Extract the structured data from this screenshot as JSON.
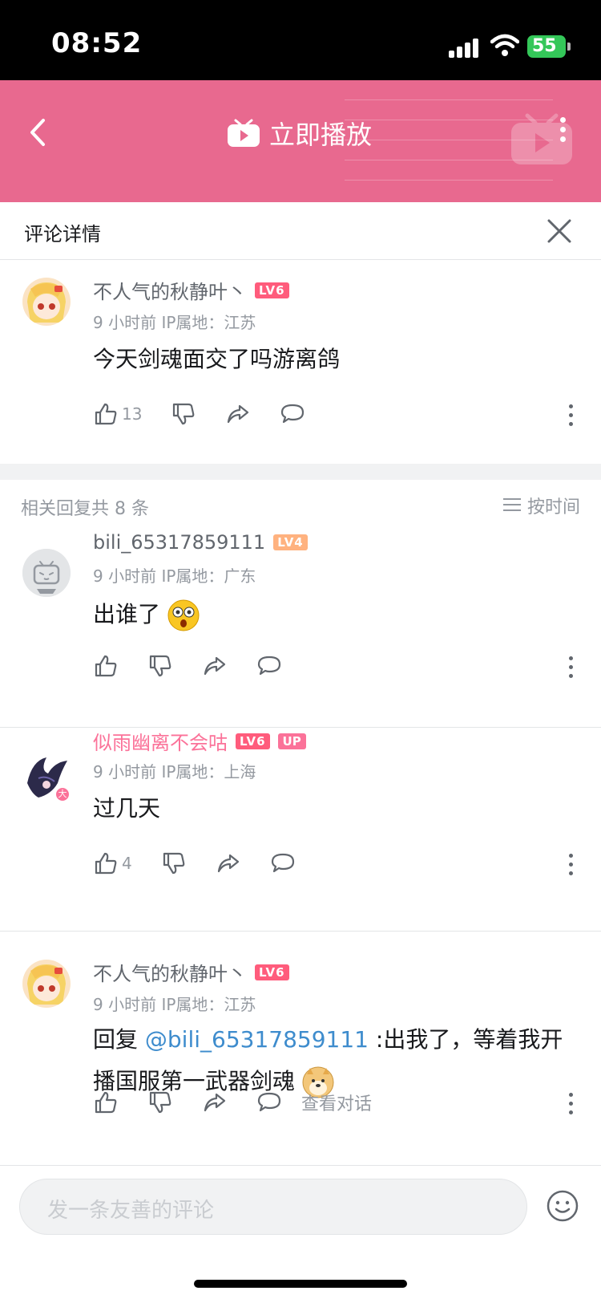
{
  "status_bar": {
    "time": "08:52",
    "battery": "55"
  },
  "header": {
    "play_label": "立即播放"
  },
  "detail": {
    "title": "评论详情"
  },
  "root_comment": {
    "username": "不人气的秋静叶丶",
    "level": "LV6",
    "meta": "9 小时前  IP属地：江苏",
    "content": "今天剑魂面交了吗游离鸽",
    "likes": "13"
  },
  "replies_section": {
    "count_label": "相关回复共 8 条",
    "sort_label": "按时间"
  },
  "replies": [
    {
      "username": "bili_65317859111",
      "level": "LV4",
      "meta": "9 小时前  IP属地：广东",
      "content": "出谁了"
    },
    {
      "username": "似雨幽离不会咕",
      "level": "LV6",
      "up_badge": "UP",
      "meta": "9 小时前  IP属地：上海",
      "content": "过几天",
      "likes": "4"
    },
    {
      "username": "不人气的秋静叶丶",
      "level": "LV6",
      "meta": "9 小时前  IP属地：江苏",
      "reply_prefix": "回复 ",
      "mention": "@bili_65317859111",
      "content": " :出我了，等着我开播国服第一武器剑魂",
      "view_conversation": "查看对话"
    }
  ],
  "input": {
    "placeholder": "发一条友善的评论"
  },
  "colors": {
    "accent_pink": "#fb7299",
    "header_pink": "#e8698f",
    "lv6": "#ff5c7c",
    "lv4": "#ffb27f",
    "mention": "#3e8ccd"
  }
}
